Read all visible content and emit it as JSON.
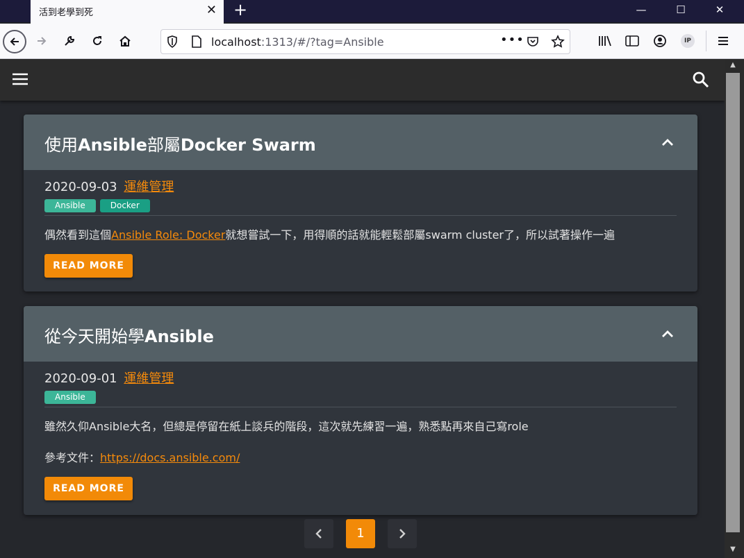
{
  "browser": {
    "tab_title": "活到老學到死",
    "url_host": "localhost",
    "url_rest": ":1313/#/?tag=Ansible",
    "ip_badge": "IP"
  },
  "posts": [
    {
      "title_parts": [
        "使用",
        "Ansible",
        "部屬",
        "Docker Swarm"
      ],
      "date": "2020-09-03",
      "category": "運維管理",
      "tags": [
        "Ansible",
        "Docker"
      ],
      "summary_before": "偶然看到這個",
      "summary_link": "Ansible Role: Docker",
      "summary_after": "就想嘗試一下，用得順的話就能輕鬆部屬swarm cluster了，所以試著操作一遍",
      "read_more": "READ MORE"
    },
    {
      "title_parts": [
        "從今天開始學",
        "Ansible"
      ],
      "date": "2020-09-01",
      "category": "運維管理",
      "tags": [
        "Ansible"
      ],
      "summary": "雖然久仰Ansible大名，但總是停留在紙上談兵的階段，這次就先練習一遍，熟悉點再來自己寫role",
      "ref_label": "參考文件：",
      "ref_link": "https://docs.ansible.com/",
      "read_more": "READ MORE"
    }
  ],
  "pagination": {
    "current": "1",
    "prev": "‹",
    "next": "›"
  },
  "colors": {
    "accent": "#f28a08",
    "tag": "#3cb698",
    "card_header": "#546066"
  }
}
